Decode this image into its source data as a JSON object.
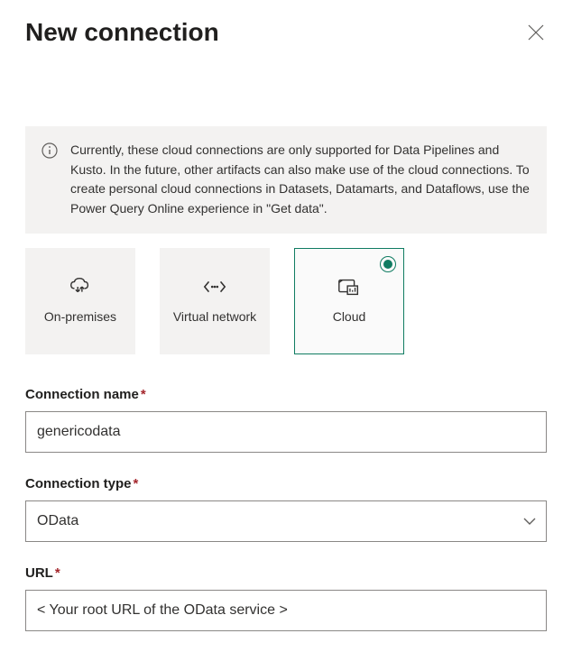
{
  "header": {
    "title": "New connection"
  },
  "info": {
    "text": "Currently, these cloud connections are only supported for Data Pipelines and Kusto. In the future, other artifacts can also make use of the cloud connections. To create personal cloud connections in Datasets, Datamarts, and Dataflows, use the Power Query Online experience in \"Get data\"."
  },
  "tiles": {
    "on_premises": "On-premises",
    "virtual_network": "Virtual network",
    "cloud": "Cloud"
  },
  "fields": {
    "connection_name": {
      "label": "Connection name",
      "value": "genericodata"
    },
    "connection_type": {
      "label": "Connection type",
      "value": "OData"
    },
    "url": {
      "label": "URL",
      "value": "< Your root URL of the OData service >"
    }
  }
}
